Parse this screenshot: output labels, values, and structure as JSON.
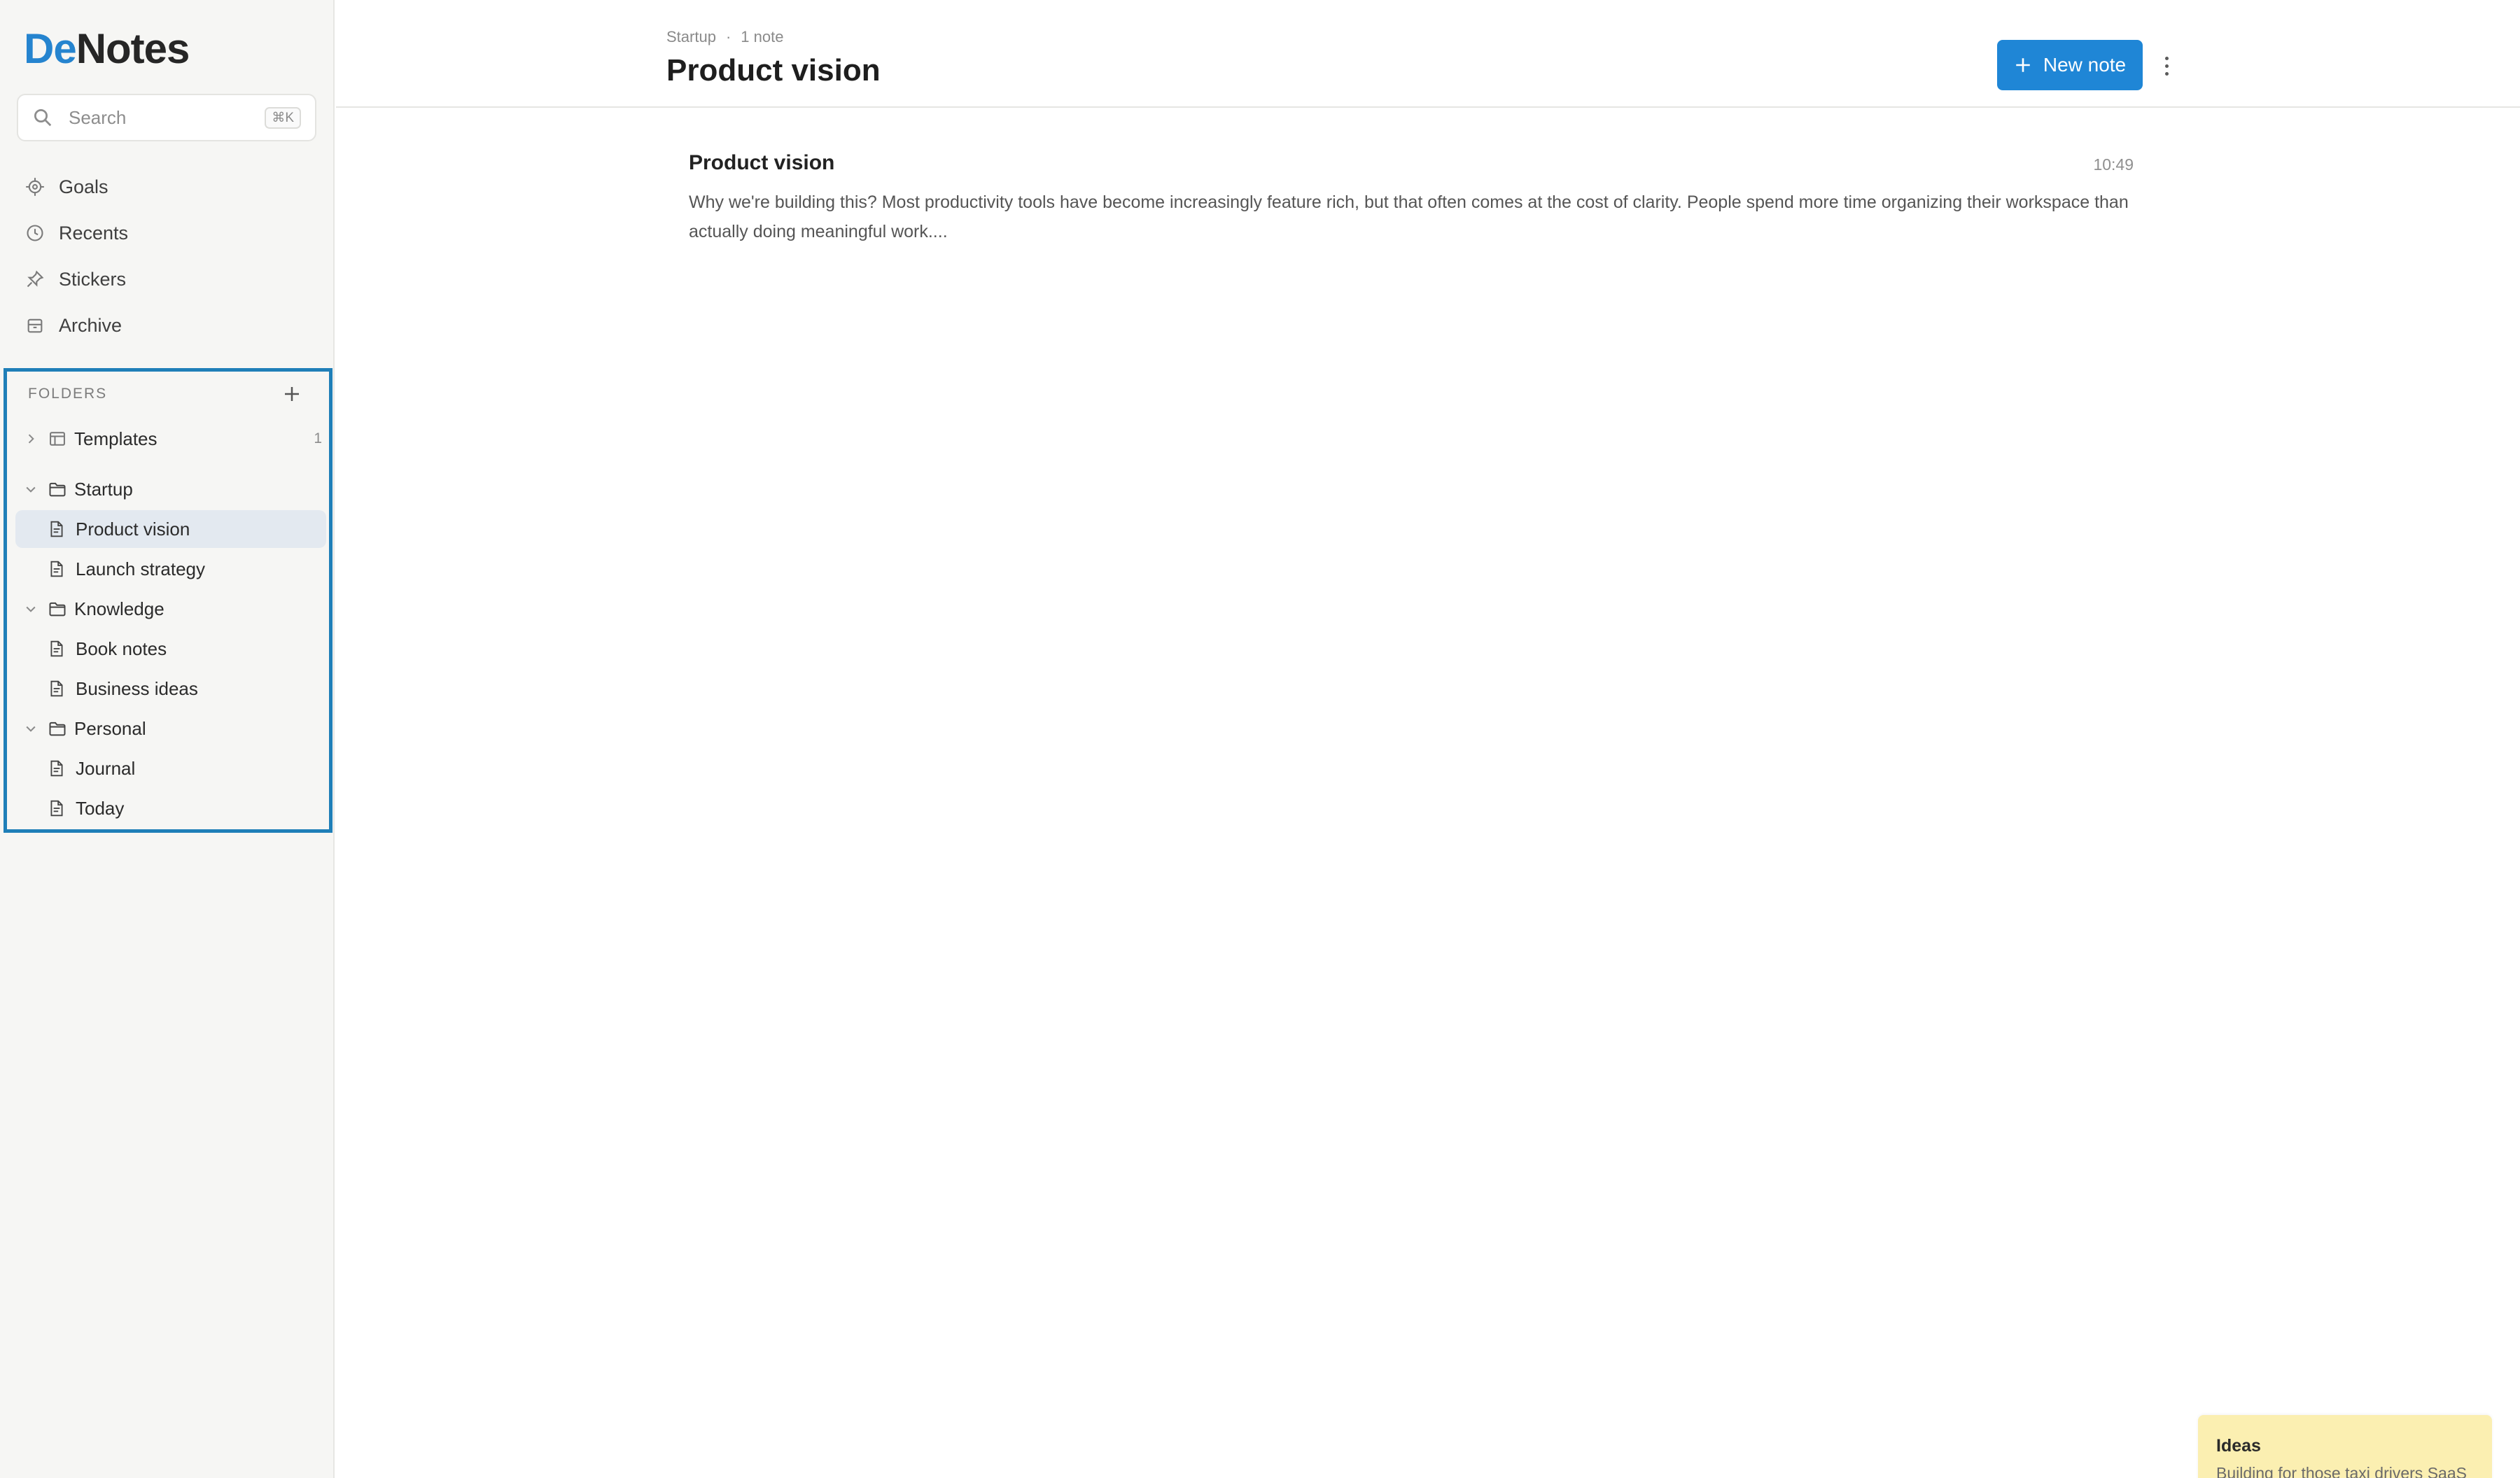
{
  "app": {
    "logo_prefix": "De",
    "logo_suffix": "Notes",
    "colors": {
      "accent": "#1f86d6",
      "logo_blue": "#2584cf",
      "selection": "#e3e9f0",
      "sticker": "#fbefb1"
    }
  },
  "sidebar": {
    "search": {
      "placeholder": "Search",
      "shortcut": "⌘K"
    },
    "nav": [
      {
        "label": "Goals",
        "icon": "goals-icon"
      },
      {
        "label": "Recents",
        "icon": "clock-icon"
      },
      {
        "label": "Stickers",
        "icon": "pin-icon"
      },
      {
        "label": "Archive",
        "icon": "archive-icon"
      }
    ],
    "folders": {
      "title": "FOLDERS",
      "tree": [
        {
          "label": "Templates",
          "type": "template-folder",
          "expanded": false,
          "count": "1"
        },
        {
          "label": "Startup",
          "type": "folder",
          "expanded": true
        },
        {
          "label": "Product vision",
          "type": "note",
          "selected": true
        },
        {
          "label": "Launch strategy",
          "type": "note"
        },
        {
          "label": "Knowledge",
          "type": "folder",
          "expanded": true
        },
        {
          "label": "Book notes",
          "type": "note"
        },
        {
          "label": "Business ideas",
          "type": "note"
        },
        {
          "label": "Personal",
          "type": "folder",
          "expanded": true
        },
        {
          "label": "Journal",
          "type": "note"
        },
        {
          "label": "Today",
          "type": "note"
        }
      ]
    }
  },
  "header": {
    "breadcrumb_folder": "Startup",
    "breadcrumb_sep": "·",
    "breadcrumb_count": "1 note",
    "title": "Product vision",
    "new_note_label": "New note"
  },
  "notes": [
    {
      "title": "Product vision",
      "time": "10:49",
      "excerpt": "Why we're building this? Most productivity tools have become increasingly feature rich, but that often comes at the cost of clarity. People spend more time organizing their workspace than actually doing meaningful work...."
    }
  ],
  "sticker": {
    "title": "Ideas",
    "body": "Building for those taxi drivers SaaS"
  }
}
